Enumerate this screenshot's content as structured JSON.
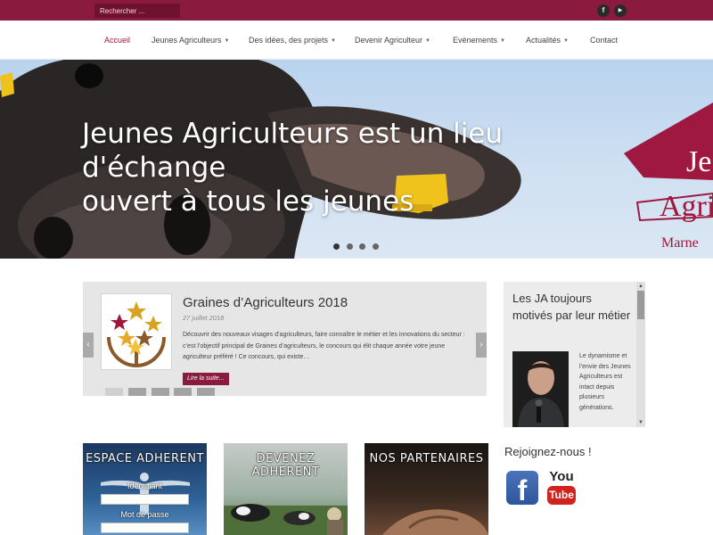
{
  "topbar": {
    "search_placeholder": "Rechercher ...",
    "social": [
      {
        "icon": "facebook-icon",
        "glyph": "f"
      },
      {
        "icon": "youtube-icon",
        "glyph": "▶"
      }
    ]
  },
  "nav": {
    "items": [
      {
        "label": "Accueil",
        "dropdown": false,
        "active": true
      },
      {
        "label": "Jeunes Agriculteurs",
        "dropdown": true
      },
      {
        "label": "Des idées, des projets",
        "dropdown": true
      },
      {
        "label": "Devenir Agriculteur",
        "dropdown": true
      },
      {
        "label": "Evènements",
        "dropdown": true
      },
      {
        "label": "Actualités",
        "dropdown": true
      },
      {
        "label": "Contact",
        "dropdown": false
      }
    ]
  },
  "hero": {
    "caption_line1": "Jeunes Agriculteurs est un lieu d'échange",
    "caption_line2": "ouvert à tous les jeunes",
    "logo_text_1": "Je",
    "logo_text_2": "Agri",
    "logo_text_3": "Marne",
    "slides_total": 4,
    "slide_active": 1
  },
  "news_slider": {
    "title": "Graines d’Agriculteurs 2018",
    "date": "27 juillet 2018",
    "excerpt": "Découvrir des nouveaux visages d’agriculteurs, faire connaître le métier et les innovations du secteur : c’est l’objectif principal de Graines d’agriculteurs, le concours qui élit chaque année votre jeune agriculteur préféré ! Ce concours, qui existe…",
    "read_more": "Lire la suite...",
    "prev": "‹",
    "next": "›",
    "pages_total": 5,
    "page_active": 1
  },
  "ja_box": {
    "title": "Les JA toujours motivés par leur métier",
    "text": "Le dynamisme et l’envie des Jeunes Agriculteurs est intact depuis plusieurs générations.",
    "scroll_up": "▲",
    "scroll_down": "▼"
  },
  "tiles": {
    "espace": {
      "title": "ESPACE ADHERENT",
      "id_label": "Identifiant",
      "pw_label": "Mot de passe"
    },
    "devenez": {
      "title": "DEVENEZ ADHERENT"
    },
    "partenaires": {
      "title": "NOS PARTENAIRES"
    }
  },
  "join": {
    "title": "Rejoignez-nous !",
    "facebook": "f",
    "youtube_you": "You",
    "youtube_tube": "Tube"
  },
  "colors": {
    "brand": "#8a1a3e",
    "active_nav": "#a0163d"
  }
}
